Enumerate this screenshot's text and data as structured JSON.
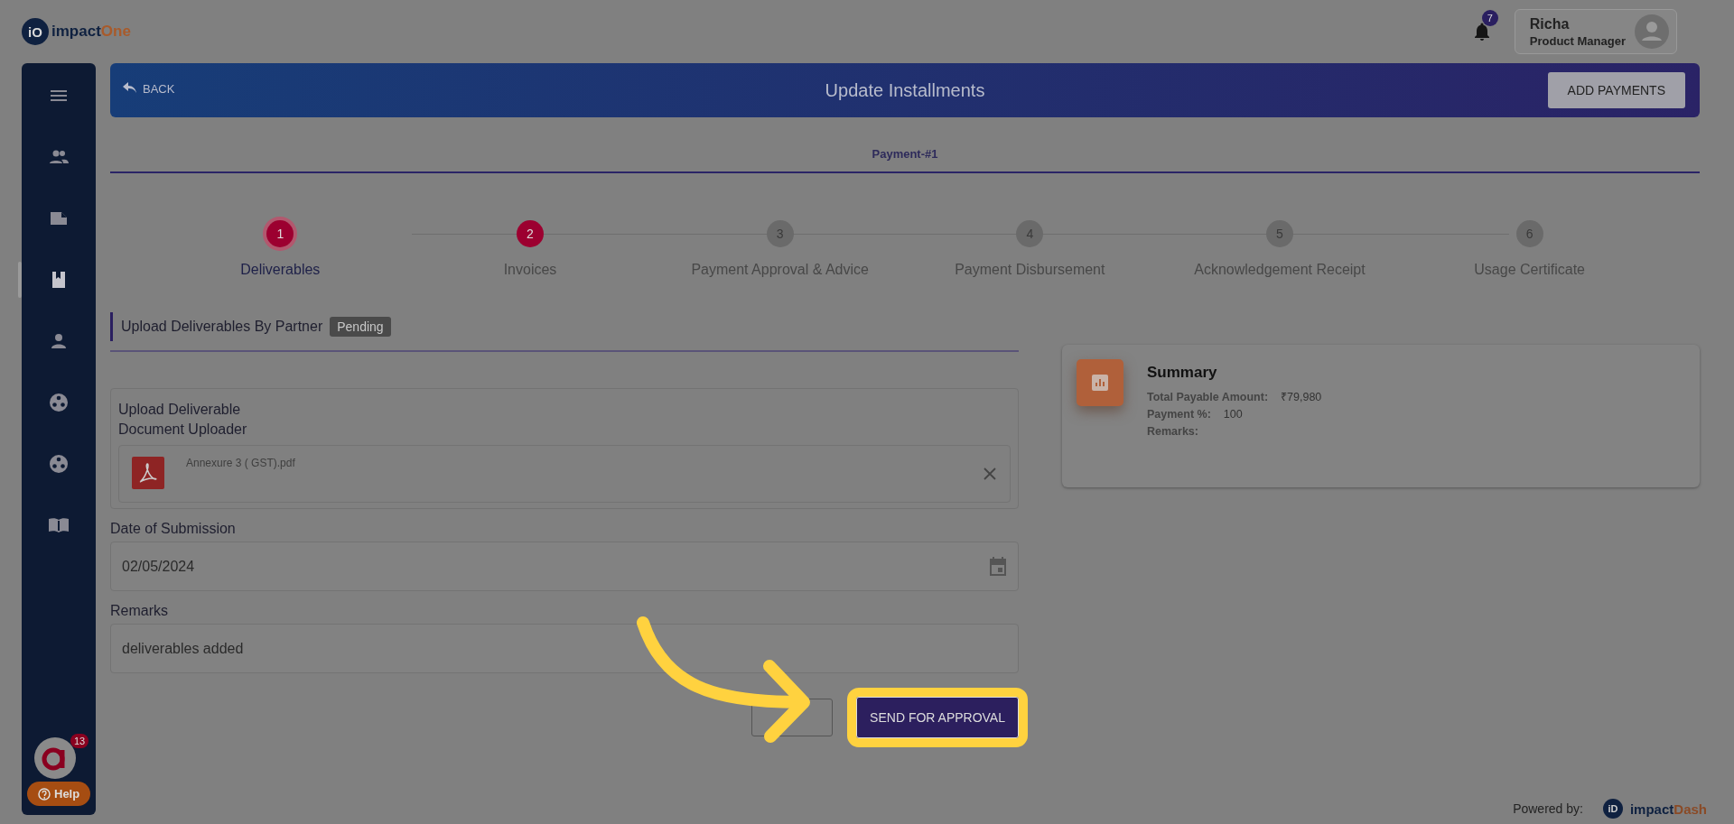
{
  "header": {
    "logo": {
      "mark": "iO",
      "prefix": "impact",
      "suffix": "One"
    },
    "notifications": "7",
    "user": {
      "name": "Richa",
      "role": "Product Manager"
    }
  },
  "sidebar": {
    "items": [
      {
        "kind": "menu",
        "selected": false
      },
      {
        "kind": "people",
        "selected": false
      },
      {
        "kind": "folder",
        "selected": false
      },
      {
        "kind": "book",
        "selected": true
      },
      {
        "kind": "person",
        "selected": false
      },
      {
        "kind": "group",
        "selected": false
      },
      {
        "kind": "group",
        "selected": false
      },
      {
        "kind": "reader",
        "selected": false
      }
    ],
    "chat_badge": "13",
    "help": "Help"
  },
  "title_bar": {
    "back": "BACK",
    "title": "Update Installments",
    "action": "ADD PAYMENTS"
  },
  "tabs": [
    {
      "label": "Payment-#1",
      "selected": true
    }
  ],
  "steps": [
    {
      "number": "1",
      "label": "Deliverables",
      "selected": true,
      "completed": true
    },
    {
      "number": "2",
      "label": "Invoices",
      "selected": false,
      "completed": true
    },
    {
      "number": "3",
      "label": "Payment Approval & Advice",
      "selected": false,
      "completed": false
    },
    {
      "number": "4",
      "label": "Payment Disbursement",
      "selected": false,
      "completed": false
    },
    {
      "number": "5",
      "label": "Acknowledgement Receipt",
      "selected": false,
      "completed": false
    },
    {
      "number": "6",
      "label": "Usage Certificate",
      "selected": false,
      "completed": false
    }
  ],
  "section": {
    "title": "Upload Deliverables By Partner",
    "badge": "Pending"
  },
  "upload": {
    "title": "Upload Deliverable",
    "subtitle": "Document Uploader",
    "file": "Annexure 3 ( GST).pdf"
  },
  "fields": [
    {
      "kind": "date",
      "label": "Date of Submission",
      "value": "02/05/2024"
    },
    {
      "kind": "text",
      "label": "Remarks",
      "value": "deliverables added"
    }
  ],
  "buttons": [
    {
      "kind": "outline",
      "highlighted": false
    },
    {
      "kind": "primary",
      "label": "SEND FOR APPROVAL",
      "highlighted": true
    }
  ],
  "summary": {
    "title": "Summary",
    "rows": [
      {
        "label": "Total Payable Amount:",
        "value": "₹79,980"
      },
      {
        "label": "Payment %:",
        "value": "100"
      },
      {
        "label": "Remarks:"
      }
    ]
  },
  "footer": {
    "powered_by": "Powered by:",
    "mark": "iD",
    "prefix": "impact",
    "suffix": "Dash"
  }
}
